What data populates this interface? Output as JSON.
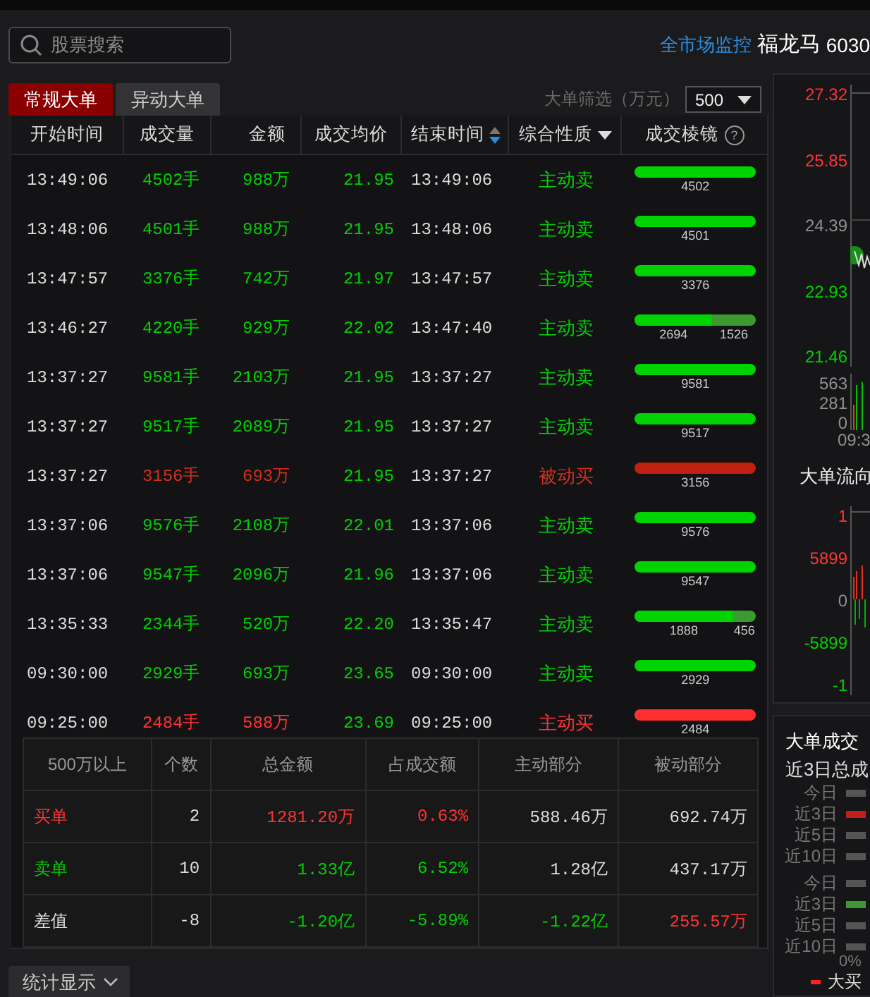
{
  "search": {
    "placeholder": "股票搜索"
  },
  "quote_header": {
    "link": "全市场监控",
    "name": "福龙马",
    "code": "6030"
  },
  "tabs": [
    {
      "label": "常规大单",
      "selected": true
    },
    {
      "label": "异动大单",
      "selected": false
    }
  ],
  "filter": {
    "label": "大单筛选（万元）",
    "value": "500"
  },
  "table": {
    "columns": [
      {
        "label": "开始时间",
        "kind": "plain"
      },
      {
        "label": "成交量",
        "kind": "plain"
      },
      {
        "label": "金额",
        "kind": "plain"
      },
      {
        "label": "成交均价",
        "kind": "plain"
      },
      {
        "label": "结束时间",
        "kind": "sort"
      },
      {
        "label": "综合性质",
        "kind": "dropdown"
      },
      {
        "label": "成交棱镜",
        "kind": "help",
        "icon_text": "?"
      }
    ],
    "rows": [
      {
        "start": "13:49:06",
        "volume": "4502手",
        "amount": "988万",
        "price": "21.95",
        "end": "13:49:06",
        "nature": "主动卖",
        "kind": "active_sell",
        "prism": {
          "kind": "sell",
          "level": 1,
          "labels": [
            "4502"
          ]
        }
      },
      {
        "start": "13:48:06",
        "volume": "4501手",
        "amount": "988万",
        "price": "21.95",
        "end": "13:48:06",
        "nature": "主动卖",
        "kind": "active_sell",
        "prism": {
          "kind": "sell",
          "level": 1,
          "labels": [
            "4501"
          ]
        }
      },
      {
        "start": "13:47:57",
        "volume": "3376手",
        "amount": "742万",
        "price": "21.97",
        "end": "13:47:57",
        "nature": "主动卖",
        "kind": "active_sell",
        "prism": {
          "kind": "sell",
          "level": 1,
          "labels": [
            "3376"
          ]
        }
      },
      {
        "start": "13:46:27",
        "volume": "4220手",
        "amount": "929万",
        "price": "22.02",
        "end": "13:47:40",
        "nature": "主动卖",
        "kind": "active_sell",
        "prism": {
          "kind": "sell",
          "level": 0.64,
          "labels": [
            "2694",
            "1526"
          ]
        }
      },
      {
        "start": "13:37:27",
        "volume": "9581手",
        "amount": "2103万",
        "price": "21.95",
        "end": "13:37:27",
        "nature": "主动卖",
        "kind": "active_sell",
        "prism": {
          "kind": "sell",
          "level": 1,
          "labels": [
            "9581"
          ]
        }
      },
      {
        "start": "13:37:27",
        "volume": "9517手",
        "amount": "2089万",
        "price": "21.95",
        "end": "13:37:27",
        "nature": "主动卖",
        "kind": "active_sell",
        "prism": {
          "kind": "sell",
          "level": 1,
          "labels": [
            "9517"
          ]
        }
      },
      {
        "start": "13:37:27",
        "volume": "3156手",
        "amount": "693万",
        "price": "21.95",
        "end": "13:37:27",
        "nature": "被动买",
        "kind": "passive_buy",
        "prism": {
          "kind": "buy",
          "level": 0,
          "labels": [
            "3156"
          ]
        }
      },
      {
        "start": "13:37:06",
        "volume": "9576手",
        "amount": "2108万",
        "price": "22.01",
        "end": "13:37:06",
        "nature": "主动卖",
        "kind": "active_sell",
        "prism": {
          "kind": "sell",
          "level": 1,
          "labels": [
            "9576"
          ]
        }
      },
      {
        "start": "13:37:06",
        "volume": "9547手",
        "amount": "2096万",
        "price": "21.96",
        "end": "13:37:06",
        "nature": "主动卖",
        "kind": "active_sell",
        "prism": {
          "kind": "sell",
          "level": 1,
          "labels": [
            "9547"
          ]
        }
      },
      {
        "start": "13:35:33",
        "volume": "2344手",
        "amount": "520万",
        "price": "22.20",
        "end": "13:35:47",
        "nature": "主动卖",
        "kind": "active_sell",
        "prism": {
          "kind": "sell",
          "level": 0.81,
          "labels": [
            "1888",
            "456"
          ]
        }
      },
      {
        "start": "09:30:00",
        "volume": "2929手",
        "amount": "693万",
        "price": "23.65",
        "end": "09:30:00",
        "nature": "主动卖",
        "kind": "active_sell",
        "prism": {
          "kind": "sell",
          "level": 1,
          "labels": [
            "2929"
          ]
        }
      },
      {
        "start": "09:25:00",
        "volume": "2484手",
        "amount": "588万",
        "price": "23.69",
        "end": "09:25:00",
        "nature": "主动买",
        "kind": "active_buy",
        "prism": {
          "kind": "buy",
          "level": 1,
          "labels": [
            "2484"
          ]
        }
      }
    ]
  },
  "summary": {
    "columns": [
      "500万以上",
      "个数",
      "总金额",
      "占成交额",
      "主动部分",
      "被动部分"
    ],
    "rows": [
      {
        "cells": [
          {
            "text": "买单",
            "kind": "up"
          },
          {
            "text": "2",
            "kind": "flat"
          },
          {
            "text": "1281.20万",
            "kind": "up"
          },
          {
            "text": "0.63%",
            "kind": "up"
          },
          {
            "text": "588.46万",
            "kind": "flat"
          },
          {
            "text": "692.74万",
            "kind": "flat"
          }
        ]
      },
      {
        "cells": [
          {
            "text": "卖单",
            "kind": "down"
          },
          {
            "text": "10",
            "kind": "flat"
          },
          {
            "text": "1.33亿",
            "kind": "down"
          },
          {
            "text": "6.52%",
            "kind": "down"
          },
          {
            "text": "1.28亿",
            "kind": "flat"
          },
          {
            "text": "437.17万",
            "kind": "flat"
          }
        ]
      },
      {
        "cells": [
          {
            "text": "差值",
            "kind": "flat"
          },
          {
            "text": "-8",
            "kind": "flat"
          },
          {
            "text": "-1.20亿",
            "kind": "down"
          },
          {
            "text": "-5.89%",
            "kind": "down"
          },
          {
            "text": "-1.22亿",
            "kind": "down"
          },
          {
            "text": "255.57万",
            "kind": "up"
          }
        ]
      }
    ]
  },
  "stats_button": {
    "label": "统计显示"
  },
  "price_axis": [
    {
      "text": "27.32",
      "kind": "up"
    },
    {
      "text": "25.85",
      "kind": "up"
    },
    {
      "text": "24.39",
      "kind": "flat"
    },
    {
      "text": "22.93",
      "kind": "down"
    },
    {
      "text": "21.46",
      "kind": "down"
    }
  ],
  "volume_axis": [
    "563",
    "281",
    "0"
  ],
  "time_label": "09:3",
  "flow": {
    "title": "大单流向",
    "axis": [
      {
        "text": "1",
        "kind": "up"
      },
      {
        "text": "5899",
        "kind": "up"
      },
      {
        "text": "0",
        "kind": "flat"
      },
      {
        "text": "-5899",
        "kind": "down"
      },
      {
        "text": "-1",
        "kind": "down"
      }
    ]
  },
  "turnover": {
    "title": "大单成交",
    "subtitle": "近3日总成",
    "groups": [
      {
        "kind": "buy",
        "rows": [
          {
            "label": "今日",
            "selected": false
          },
          {
            "label": "近3日",
            "selected": true
          },
          {
            "label": "近5日",
            "selected": false
          },
          {
            "label": "近10日",
            "selected": false
          }
        ]
      },
      {
        "kind": "sell",
        "rows": [
          {
            "label": "今日",
            "selected": false
          },
          {
            "label": "近3日",
            "selected": true
          },
          {
            "label": "近5日",
            "selected": false
          },
          {
            "label": "近10日",
            "selected": false
          }
        ]
      }
    ],
    "axis_label": "0%",
    "legend": "大买"
  }
}
